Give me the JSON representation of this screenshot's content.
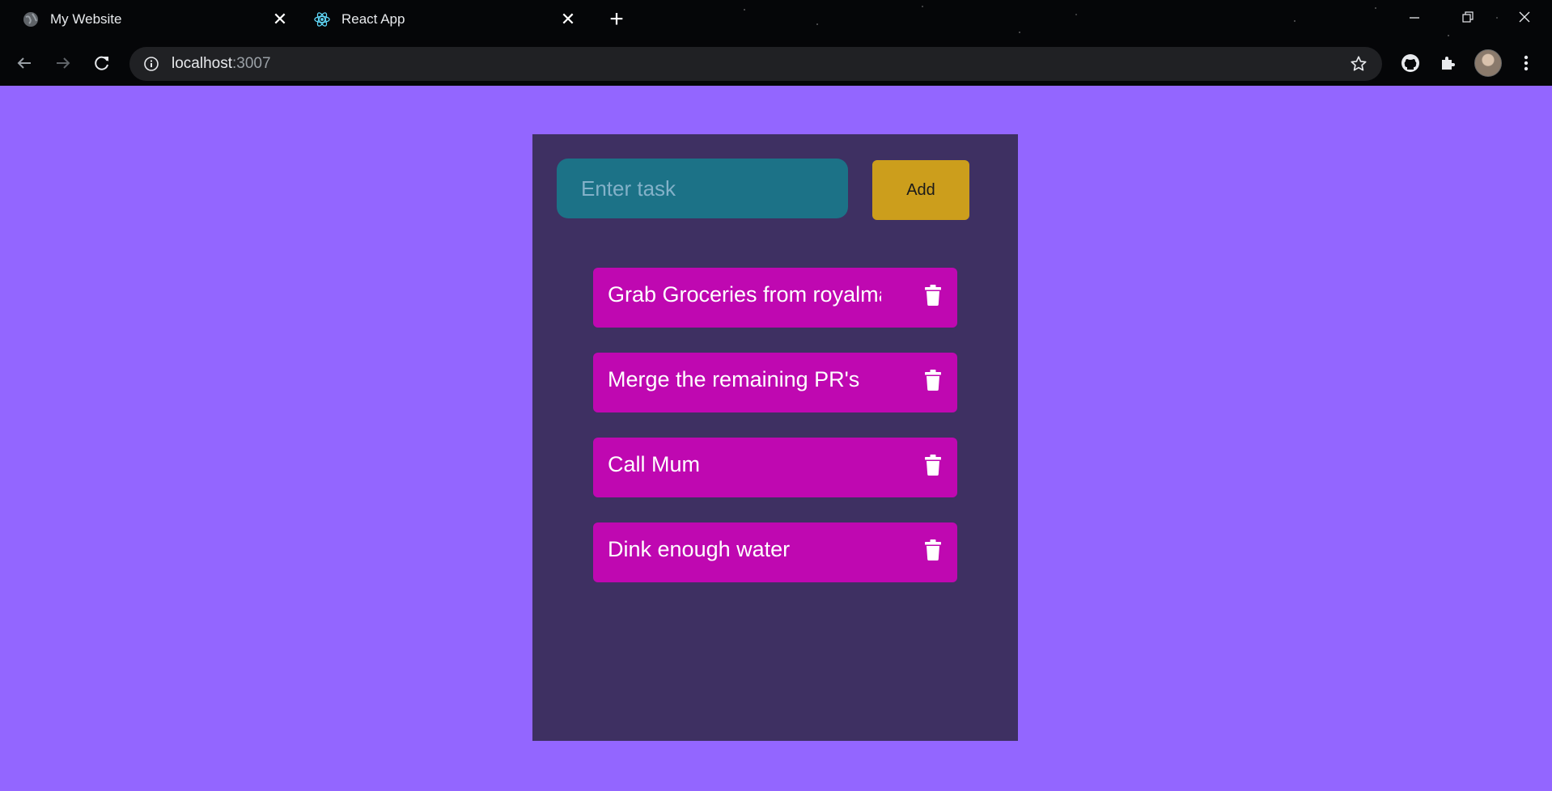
{
  "browser": {
    "tabs": [
      {
        "title": "My Website",
        "favicon": "globe-icon"
      },
      {
        "title": "React App",
        "favicon": "react-icon",
        "active": true
      }
    ],
    "address": {
      "host": "localhost",
      "port": ":3007"
    }
  },
  "app": {
    "input_placeholder": "Enter task",
    "add_label": "Add",
    "tasks": [
      {
        "text": "Grab Groceries from royalmart"
      },
      {
        "text": "Merge the remaining PR's"
      },
      {
        "text": "Call Mum"
      },
      {
        "text": "Dink enough water"
      }
    ]
  },
  "colors": {
    "page_background": "#9366ff",
    "panel_background": "#3e3062",
    "input_background": "#1c7287",
    "add_button": "#cc9e1c",
    "task_background": "#bf08b1"
  }
}
